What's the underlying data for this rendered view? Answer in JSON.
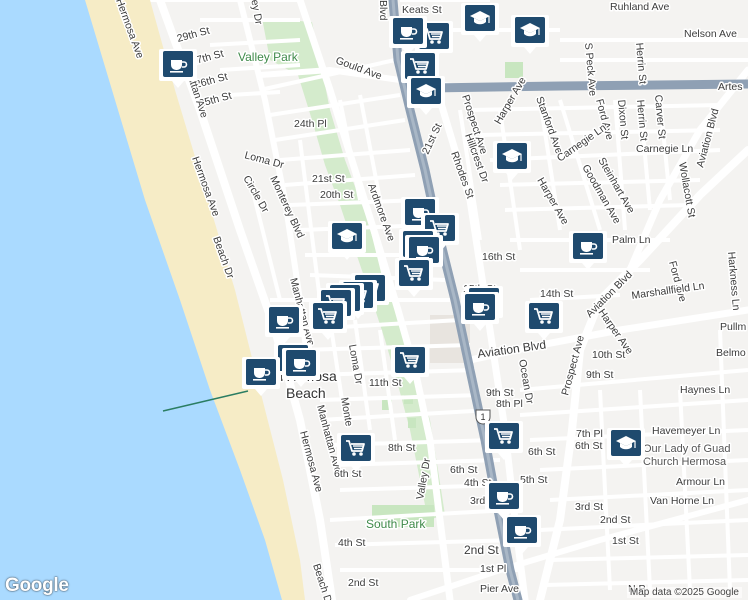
{
  "map": {
    "logo": "Google",
    "attribution": "Map data ©2025 Google",
    "colors": {
      "water": "#aadaff",
      "beach": "#f6ecc6",
      "land": "#f4f3f1",
      "park": "#c8e6c0",
      "road": "#ffffff",
      "highway": "#8fa0b4",
      "pin": "#1f4a6e"
    },
    "labels": {
      "streets": [
        {
          "text": "Keats St"
        },
        {
          "text": "Ruhland Ave"
        },
        {
          "text": "Nelson Ave"
        },
        {
          "text": "29th St"
        },
        {
          "text": "27th St"
        },
        {
          "text": "26th St"
        },
        {
          "text": "25th St"
        },
        {
          "text": "Gould Ave"
        },
        {
          "text": "Artes"
        },
        {
          "text": "24th Pl"
        },
        {
          "text": "Loma Dr"
        },
        {
          "text": "Circle Dr"
        },
        {
          "text": "Monterey Blvd"
        },
        {
          "text": "21st St"
        },
        {
          "text": "20th St"
        },
        {
          "text": "Ardmore Ave"
        },
        {
          "text": "Hermosa Ave"
        },
        {
          "text": "Manhattan Ave"
        },
        {
          "text": "Beach Dr"
        },
        {
          "text": "16th St"
        },
        {
          "text": "15th St"
        },
        {
          "text": "14th St"
        },
        {
          "text": "11th St"
        },
        {
          "text": "10th St"
        },
        {
          "text": "9th St"
        },
        {
          "text": "8th Pl"
        },
        {
          "text": "8th St"
        },
        {
          "text": "7th Pl"
        },
        {
          "text": "6th St"
        },
        {
          "text": "5th St"
        },
        {
          "text": "4th St"
        },
        {
          "text": "3rd St"
        },
        {
          "text": "2nd St"
        },
        {
          "text": "1st St"
        },
        {
          "text": "1st Pl"
        },
        {
          "text": "Pier Ave"
        },
        {
          "text": "Aviation Blvd"
        },
        {
          "text": "Prospect Ave"
        },
        {
          "text": "Harper Ave"
        },
        {
          "text": "Stanford Ave"
        },
        {
          "text": "Ford Ave"
        },
        {
          "text": "Dixon St"
        },
        {
          "text": "Herrin St"
        },
        {
          "text": "Carver St"
        },
        {
          "text": "S Peck Ave"
        },
        {
          "text": "Carnegie Ln"
        },
        {
          "text": "Goodman Ave"
        },
        {
          "text": "Steinhart Ave"
        },
        {
          "text": "Palm Ln"
        },
        {
          "text": "Wollacott St"
        },
        {
          "text": "Harkness Ln"
        },
        {
          "text": "Marshallfield Ln"
        },
        {
          "text": "Pullm"
        },
        {
          "text": "Belmo"
        },
        {
          "text": "Haynes Ln"
        },
        {
          "text": "Havemeyer Ln"
        },
        {
          "text": "Armour Ln"
        },
        {
          "text": "Van Horne Ln"
        },
        {
          "text": "Ocean Dr"
        },
        {
          "text": "Valley Dr"
        },
        {
          "text": "Hillcrest Dr"
        },
        {
          "text": "Rhodes St"
        },
        {
          "text": "Loma Dr"
        },
        {
          "text": "Monte"
        },
        {
          "text": "N P"
        },
        {
          "text": "Beach D"
        },
        {
          "text": "ley Dr"
        },
        {
          "text": "Blvd"
        }
      ],
      "parks": [
        {
          "text": "Valley Park"
        },
        {
          "text": "South Park"
        }
      ],
      "places": [
        {
          "text": "Hermosa"
        },
        {
          "text": "Beach"
        },
        {
          "text": "Our Lady of Guad"
        },
        {
          "text": "Church Hermosa"
        }
      ],
      "route_shield": "1"
    },
    "pins": [
      {
        "icon": "coffee-icon",
        "type": "cafe"
      },
      {
        "icon": "cart-icon",
        "type": "store"
      },
      {
        "icon": "school-icon",
        "type": "school"
      }
    ]
  }
}
